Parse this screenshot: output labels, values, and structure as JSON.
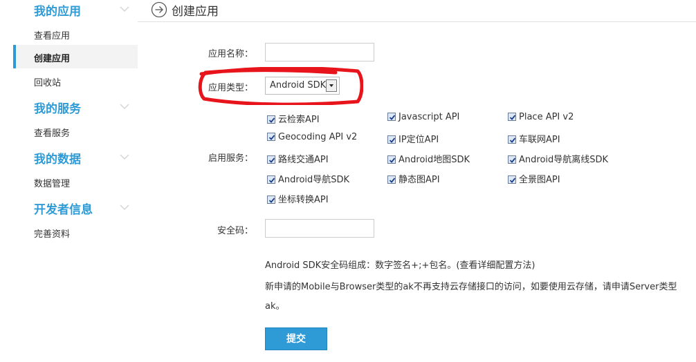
{
  "sidebar": {
    "sections": [
      {
        "title": "我的应用",
        "items": [
          "查看应用",
          "创建应用",
          "回收站"
        ]
      },
      {
        "title": "我的服务",
        "items": [
          "查看服务"
        ]
      },
      {
        "title": "我的数据",
        "items": [
          "数据管理"
        ]
      },
      {
        "title": "开发者信息",
        "items": [
          "完善资料"
        ]
      }
    ],
    "active_item": "创建应用"
  },
  "page": {
    "title": "创建应用"
  },
  "form": {
    "app_name_label": "应用名称：",
    "app_name_value": "",
    "app_type_label": "应用类型：",
    "app_type_value": "Android SDK",
    "services_label": "启用服务：",
    "services": [
      {
        "label": "云检索API",
        "checked": true
      },
      {
        "label": "Javascript API",
        "checked": true
      },
      {
        "label": "Place API v2",
        "checked": true
      },
      {
        "label": "Geocoding API v2",
        "checked": true
      },
      {
        "label": "IP定位API",
        "checked": true
      },
      {
        "label": "车联网API",
        "checked": true
      },
      {
        "label": "路线交通API",
        "checked": true
      },
      {
        "label": "Android地图SDK",
        "checked": true
      },
      {
        "label": "Android导航离线SDK",
        "checked": true
      },
      {
        "label": "Android导航SDK",
        "checked": true
      },
      {
        "label": "静态图API",
        "checked": true
      },
      {
        "label": "全景图API",
        "checked": true
      },
      {
        "label": "坐标转换API",
        "checked": true
      }
    ],
    "security_code_label": "安全码：",
    "security_code_value": "",
    "info_line1": "Android SDK安全码组成：数字签名+;+包名。(查看详细配置方法)",
    "info_line2": "新申请的Mobile与Browser类型的ak不再支持云存储接口的访问，如要使用云存储，请申请Server类型",
    "info_line3": "ak。",
    "submit_label": "提交"
  },
  "colors": {
    "accent": "#2f9bd6",
    "annotation": "#e8141b"
  }
}
